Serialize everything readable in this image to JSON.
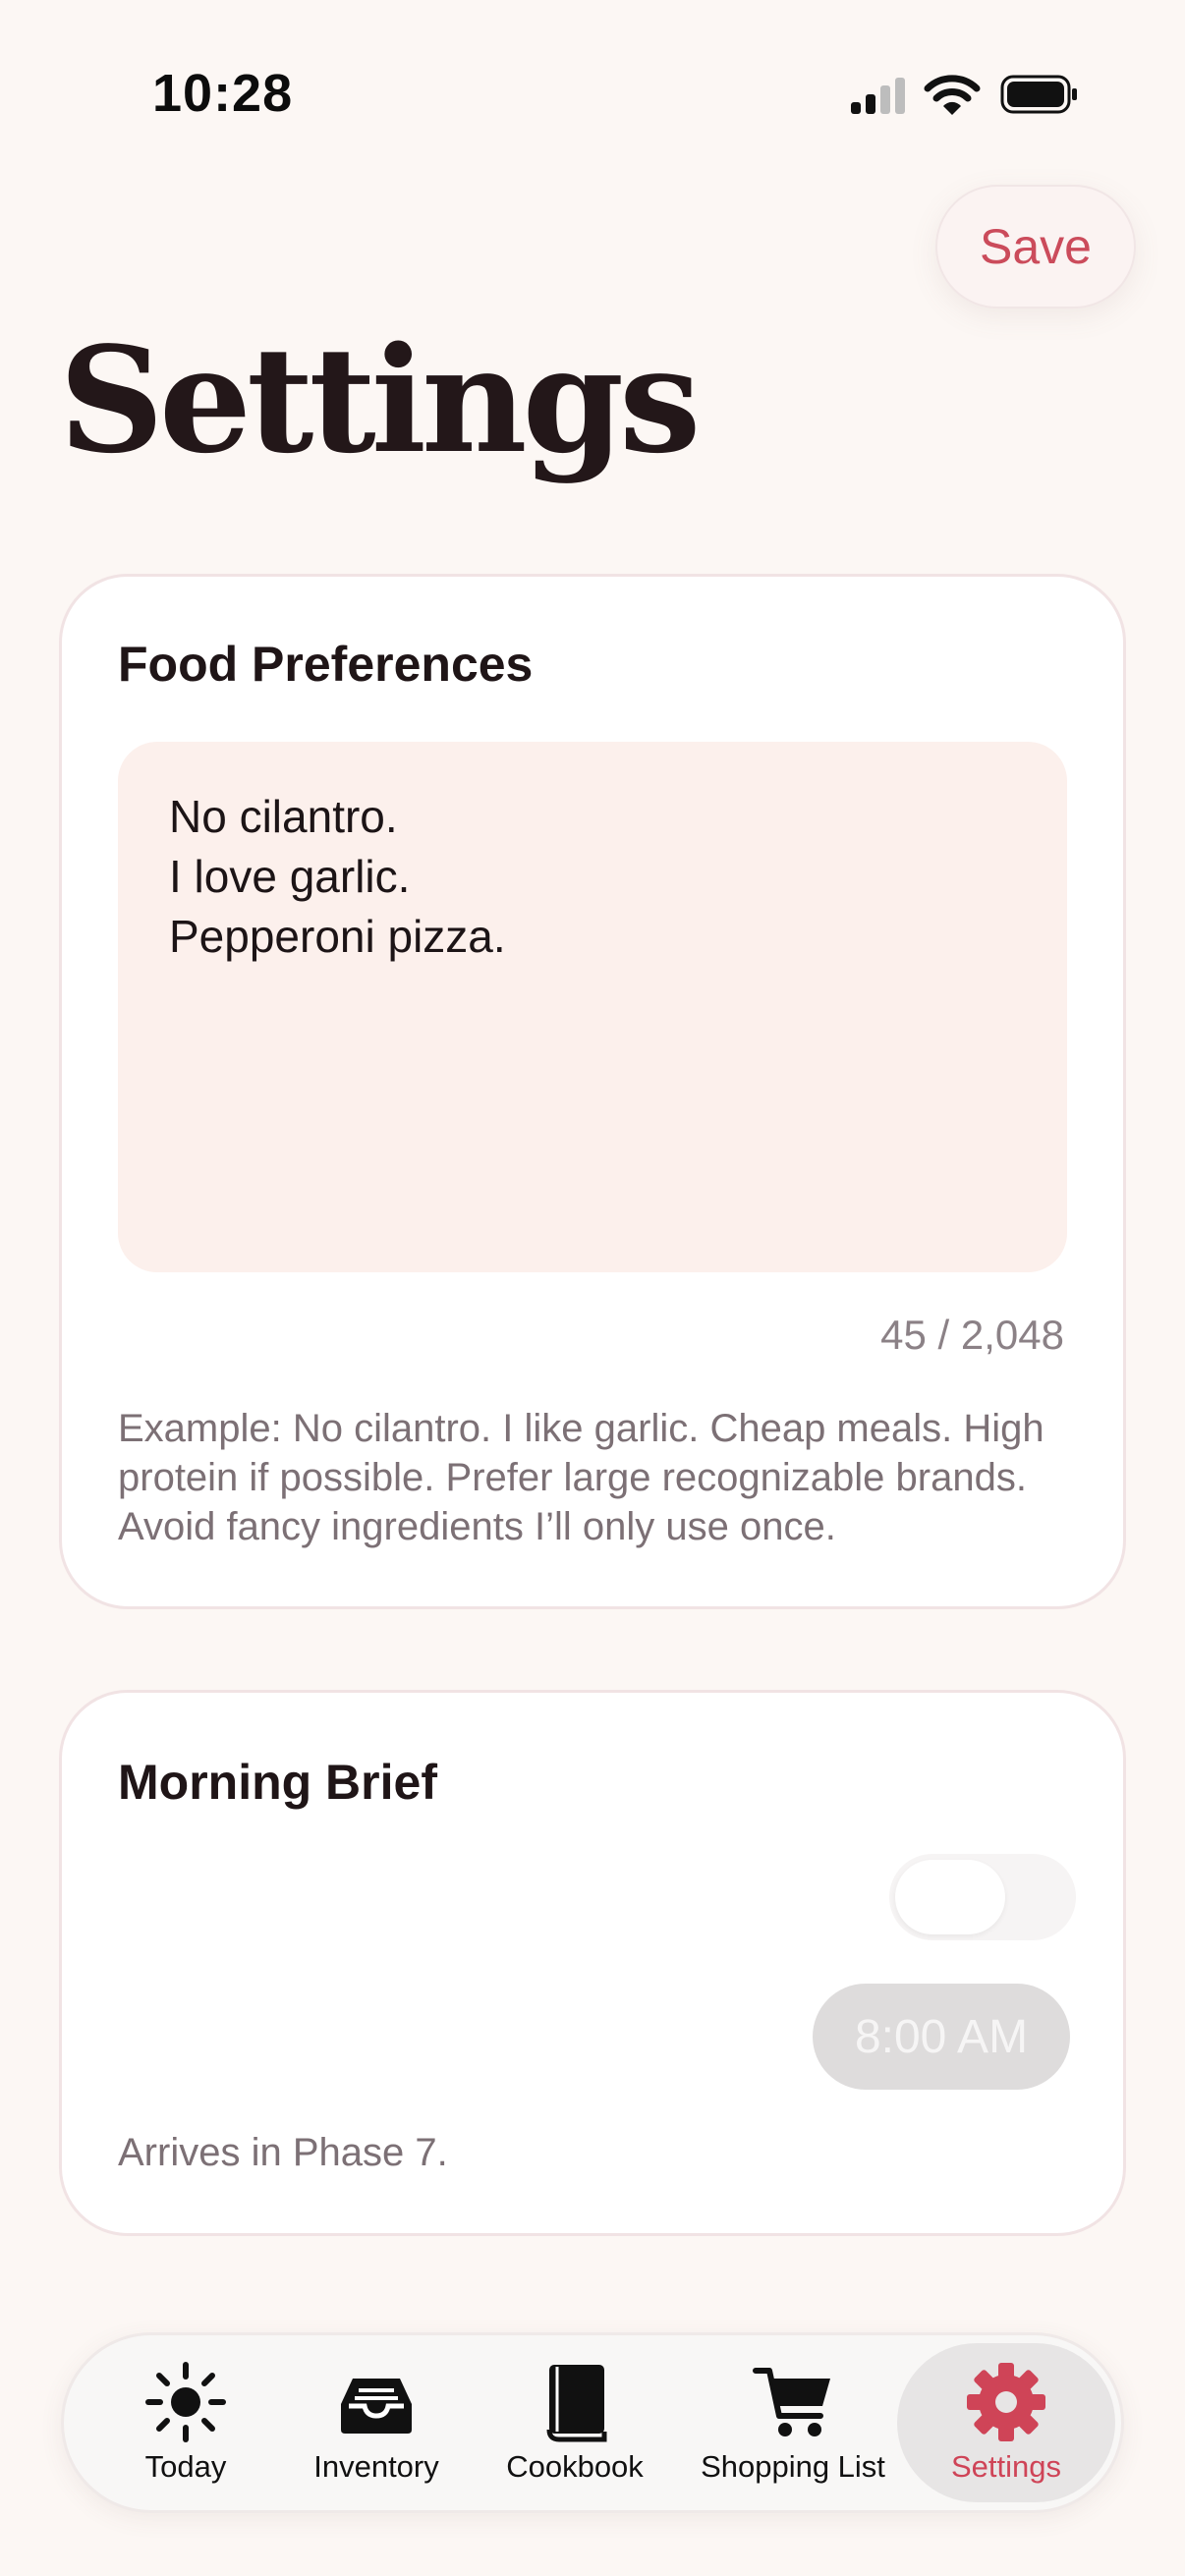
{
  "status_bar": {
    "time": "10:28"
  },
  "header": {
    "save_label": "Save",
    "title": "Settings"
  },
  "food_preferences": {
    "title": "Food Preferences",
    "lines": [
      "No cilantro.",
      "I love garlic.",
      "Pepperoni pizza."
    ],
    "char_count": "45 / 2,048",
    "hint": "Example: No cilantro. I like garlic. Cheap meals. High protein if possible. Prefer large recognizable brands. Avoid fancy ingredients I’ll only use once."
  },
  "morning_brief": {
    "title": "Morning Brief",
    "toggle_on": false,
    "time": "8:00 AM",
    "note": "Arrives in Phase 7."
  },
  "tabs": [
    {
      "label": "Today",
      "icon": "sun-icon"
    },
    {
      "label": "Inventory",
      "icon": "tray-icon"
    },
    {
      "label": "Cookbook",
      "icon": "book-icon"
    },
    {
      "label": "Shopping List",
      "icon": "cart-icon"
    },
    {
      "label": "Settings",
      "icon": "gear-icon",
      "active": true
    }
  ],
  "colors": {
    "accent": "#cf4457",
    "background": "#fcf7f4",
    "input_background": "#fcf0ec"
  }
}
